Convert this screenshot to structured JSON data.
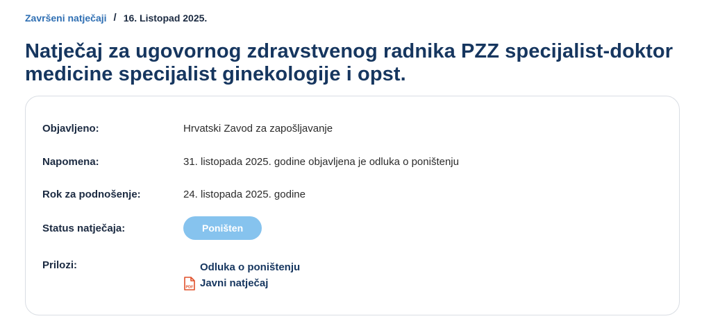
{
  "breadcrumb": {
    "link_label": "Završeni natječaji",
    "separator": "/",
    "current": "16. Listopad 2025."
  },
  "title": "Natječaj za ugovornog zdravstvenog radnika PZZ specijalist-doktor medicine specijalist ginekologije i opst.",
  "details": {
    "published_label": "Objavljeno:",
    "published_value": "Hrvatski Zavod za zapošljavanje",
    "note_label": "Napomena:",
    "note_value": "31. listopada 2025. godine objavljena je odluka o poništenju",
    "deadline_label": "Rok za podnošenje:",
    "deadline_value": "24. listopada 2025. godine",
    "status_label": "Status natječaja:",
    "status_value": "Poništen",
    "attachments_label": "Prilozi:",
    "attachments": [
      {
        "label": "Odluka o poništenju",
        "icon": "none"
      },
      {
        "label": "Javni natječaj",
        "icon": "pdf-icon"
      }
    ]
  },
  "colors": {
    "title": "#16365f",
    "link": "#2f6fb3",
    "status_badge": "#86c3ee",
    "pdf_icon": "#e0502a"
  }
}
